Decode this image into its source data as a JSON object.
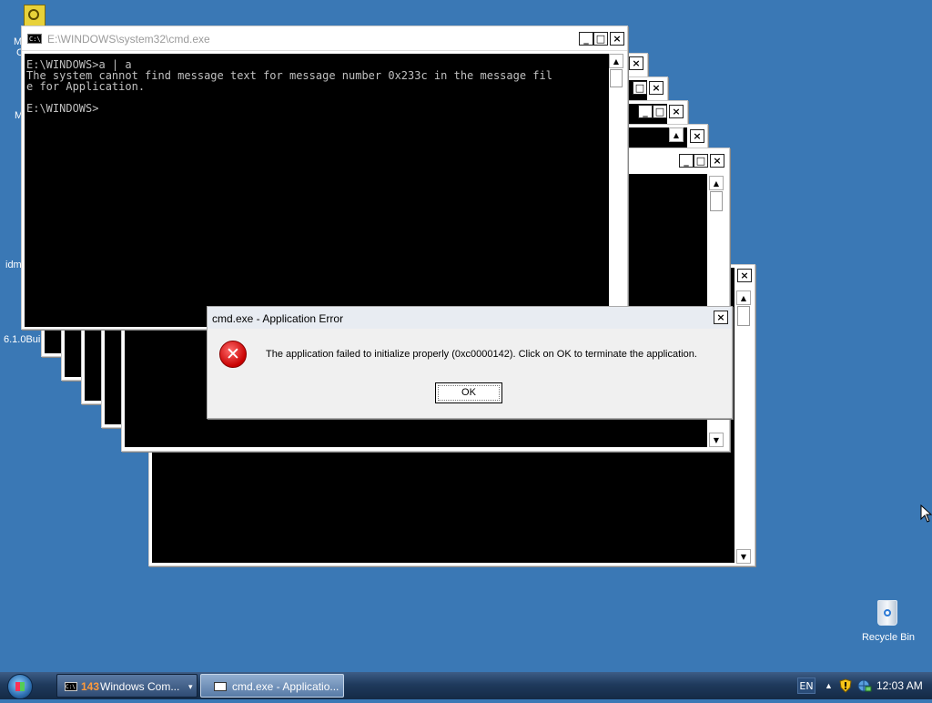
{
  "desktop": {
    "icon_labels": {
      "top_partial_1": "M",
      "top_partial_2": "C",
      "mid_partial": "M",
      "idm_partial": "idm",
      "build_partial": "6.1.0Bui"
    },
    "recycle_bin": {
      "label": "Recycle Bin",
      "icon": "recycle-bin-icon"
    }
  },
  "cmd_window": {
    "title": "E:\\WINDOWS\\system32\\cmd.exe",
    "icon_text": "C:\\",
    "console_lines": [
      "E:\\WINDOWS>a | a",
      "The system cannot find message text for message number 0x233c in the message fil",
      "e for Application.",
      "",
      "E:\\WINDOWS>"
    ],
    "buttons": {
      "minimize": "_",
      "maximize": "□",
      "close": "×"
    }
  },
  "error_dialog": {
    "title": "cmd.exe - Application Error",
    "message": "The application failed to initialize properly (0xc0000142). Click on OK to terminate the application.",
    "ok_label": "OK",
    "close_glyph": "×",
    "icon": "error-icon",
    "icon_glyph": "✕"
  },
  "taskbar": {
    "tasks": [
      {
        "count": "143",
        "label": "Windows Com...",
        "dropdown": "▾"
      },
      {
        "label": "cmd.exe - Applicatio..."
      }
    ],
    "tray": {
      "language": "EN",
      "show_hidden": "▲",
      "clock": "12:03 AM"
    }
  },
  "colors": {
    "desktop": "#3a78b5",
    "console_text": "#c0c0c0",
    "task_count": "#ff9a3c"
  }
}
